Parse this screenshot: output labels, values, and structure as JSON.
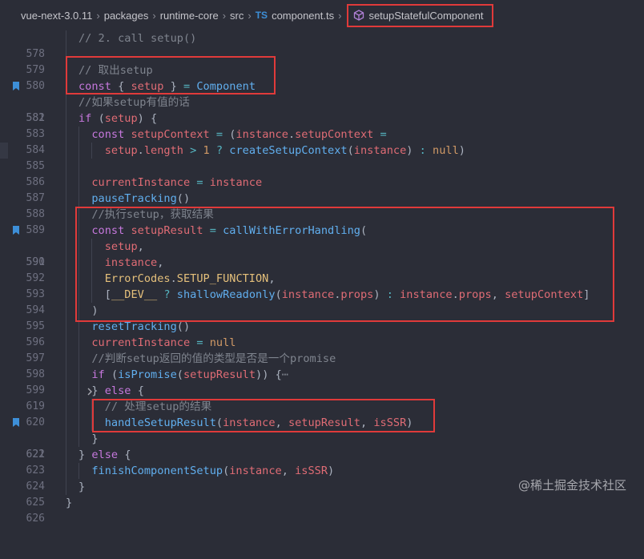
{
  "breadcrumb": {
    "project": "vue-next-3.0.11",
    "parts": [
      "packages",
      "runtime-core",
      "src"
    ],
    "file_lang": "TS",
    "file": "component.ts",
    "symbol": "setupStatefulComponent"
  },
  "lines": {
    "l578": {
      "num": "578",
      "comment": "// 2. call setup()"
    },
    "l579": {
      "num": "579"
    },
    "l580": {
      "num": "580",
      "comment": "// 取出setup"
    },
    "l581": {
      "num": "581",
      "kw": "const",
      "open": "{",
      "var": "setup",
      "close": "}",
      "eq": "=",
      "cls": "Component"
    },
    "l582": {
      "num": "582",
      "comment": "//如果setup有值的话"
    },
    "l583": {
      "num": "583",
      "kw": "if",
      "open": "(",
      "var": "setup",
      "close": ") {"
    },
    "l584": {
      "num": "584",
      "kw": "const",
      "var": "setupContext",
      "eq": "=",
      "open": "(",
      "obj": "instance",
      "dot": ".",
      "prop": "setupContext",
      "eq2": "="
    },
    "l585": {
      "num": "585",
      "var": "setup",
      "dot": ".",
      "prop": "length",
      "op": ">",
      "num_lit": "1",
      "q": "?",
      "fn": "createSetupContext",
      "open": "(",
      "arg": "instance",
      "close": ")",
      "colon": ":",
      "null": "null",
      "end": ")"
    },
    "l586": {
      "num": "586"
    },
    "l587": {
      "num": "587",
      "var": "currentInstance",
      "eq": "=",
      "val": "instance"
    },
    "l588": {
      "num": "588",
      "fn": "pauseTracking",
      "parens": "()"
    },
    "l589": {
      "num": "589",
      "comment": "//执行setup，获取结果"
    },
    "l590": {
      "num": "590",
      "kw": "const",
      "var": "setupResult",
      "eq": "=",
      "fn": "callWithErrorHandling",
      "open": "("
    },
    "l591": {
      "num": "591",
      "var": "setup",
      "comma": ","
    },
    "l592": {
      "num": "592",
      "var": "instance",
      "comma": ","
    },
    "l593": {
      "num": "593",
      "obj": "ErrorCodes",
      "dot": ".",
      "prop": "SETUP_FUNCTION",
      "comma": ","
    },
    "l594": {
      "num": "594",
      "open": "[",
      "dev": "__DEV__",
      "q": "?",
      "fn": "shallowReadonly",
      "paren": "(",
      "obj": "instance",
      "dot": ".",
      "prop": "props",
      "close": ")",
      "colon": ":",
      "obj2": "instance",
      "dot2": ".",
      "prop2": "props",
      "comma": ",",
      "ctx": "setupContext",
      "end": "]"
    },
    "l595": {
      "num": "595",
      "close": ")"
    },
    "l596": {
      "num": "596",
      "fn": "resetTracking",
      "parens": "()"
    },
    "l597": {
      "num": "597",
      "var": "currentInstance",
      "eq": "=",
      "null": "null"
    },
    "l598": {
      "num": "598",
      "comment": "//判断setup返回的值的类型是否是一个promise"
    },
    "l599": {
      "num": "599",
      "kw": "if",
      "open": "(",
      "fn": "isPromise",
      "paren": "(",
      "arg": "setupResult",
      "close": ")) {",
      "ellipsis": "⋯"
    },
    "l619": {
      "num": "619",
      "open": "}",
      "kw": "else",
      "close": "{"
    },
    "l620": {
      "num": "620",
      "comment": "// 处理setup的结果"
    },
    "l621": {
      "num": "621",
      "fn": "handleSetupResult",
      "open": "(",
      "a1": "instance",
      "c1": ",",
      "a2": "setupResult",
      "c2": ",",
      "a3": "isSSR",
      "close": ")"
    },
    "l622": {
      "num": "622",
      "close": "}"
    },
    "l623": {
      "num": "623",
      "open": "}",
      "kw": "else",
      "close": "{"
    },
    "l624": {
      "num": "624",
      "fn": "finishComponentSetup",
      "open": "(",
      "a1": "instance",
      "c1": ",",
      "a2": "isSSR",
      "close": ")"
    },
    "l625": {
      "num": "625",
      "close": "}"
    },
    "l626": {
      "num": "626",
      "close": "}"
    }
  },
  "watermark": "@稀土掘金技术社区",
  "colors": {
    "background": "#2b2d37",
    "highlight_box": "#e03a3a",
    "bookmark": "#3d8fd8"
  }
}
